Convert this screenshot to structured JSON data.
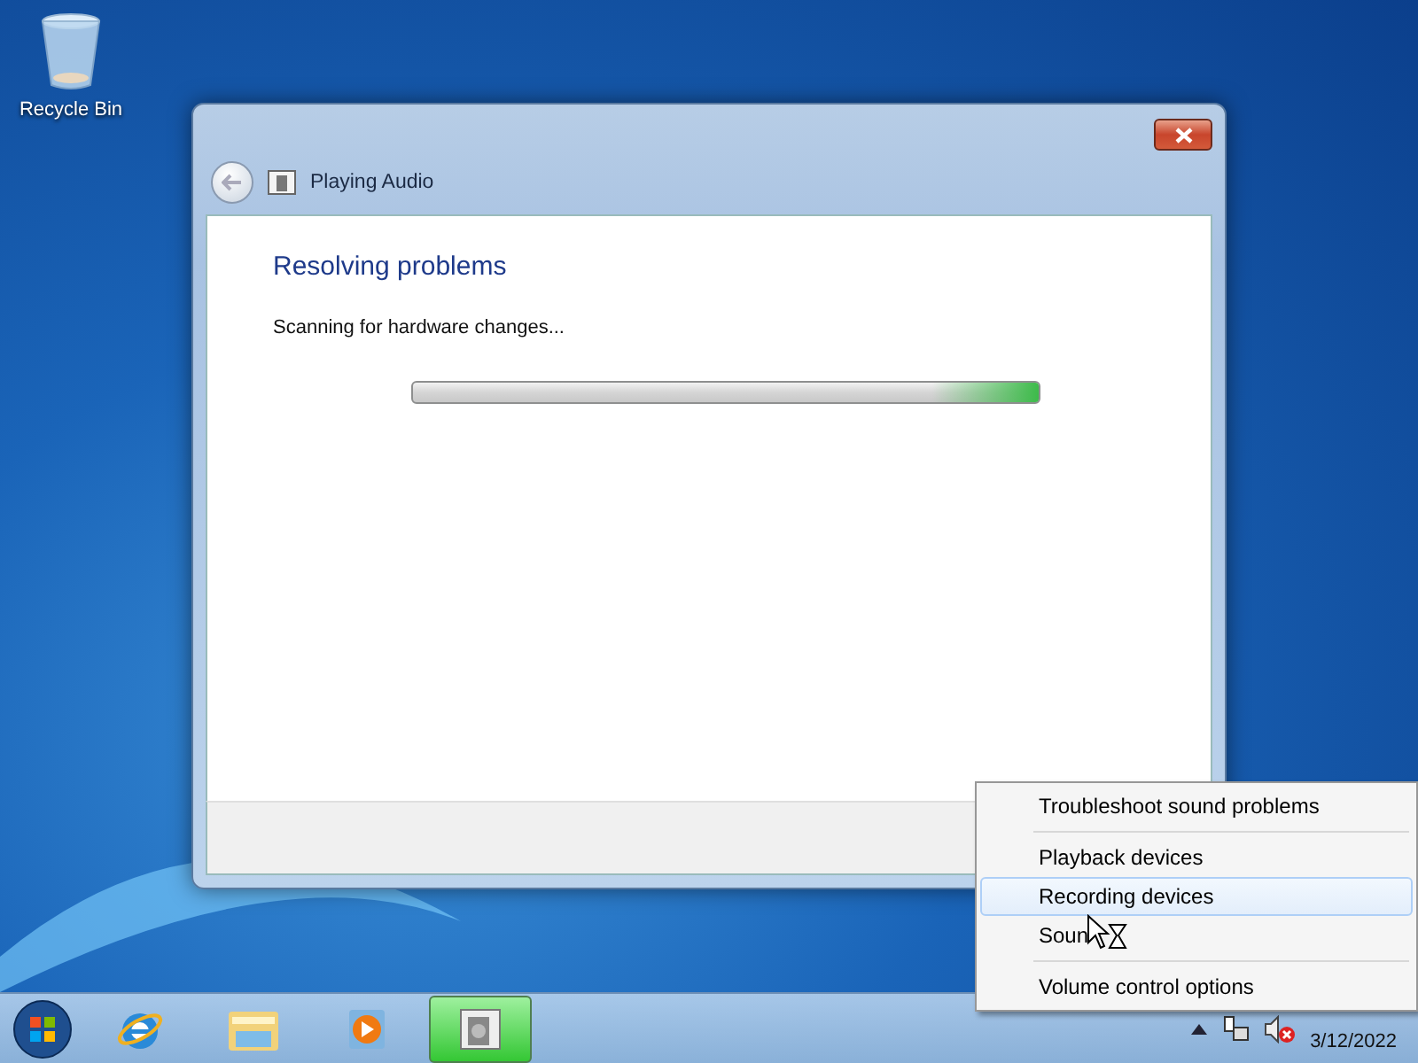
{
  "desktop": {
    "icons": [
      {
        "label": "Recycle Bin"
      }
    ]
  },
  "window": {
    "title": "Playing Audio",
    "heading": "Resolving problems",
    "status": "Scanning for hardware changes...",
    "progress": {
      "kind": "marquee",
      "level": 1
    }
  },
  "context_menu": {
    "groups": [
      [
        {
          "label": "Troubleshoot sound problems",
          "selected": false
        }
      ],
      [
        {
          "label": "Playback devices",
          "selected": false
        },
        {
          "label": "Recording devices",
          "selected": true
        },
        {
          "label": "Soun",
          "selected": false
        }
      ],
      [
        {
          "label": "Volume control options",
          "selected": false
        }
      ]
    ]
  },
  "taskbar": {
    "items": [
      {
        "kind": "ie",
        "selected": false
      },
      {
        "kind": "explorer",
        "selected": false
      },
      {
        "kind": "media",
        "selected": false
      },
      {
        "kind": "troubleshooter",
        "selected": true
      }
    ],
    "tray": {
      "date": "3/12/2022"
    }
  }
}
